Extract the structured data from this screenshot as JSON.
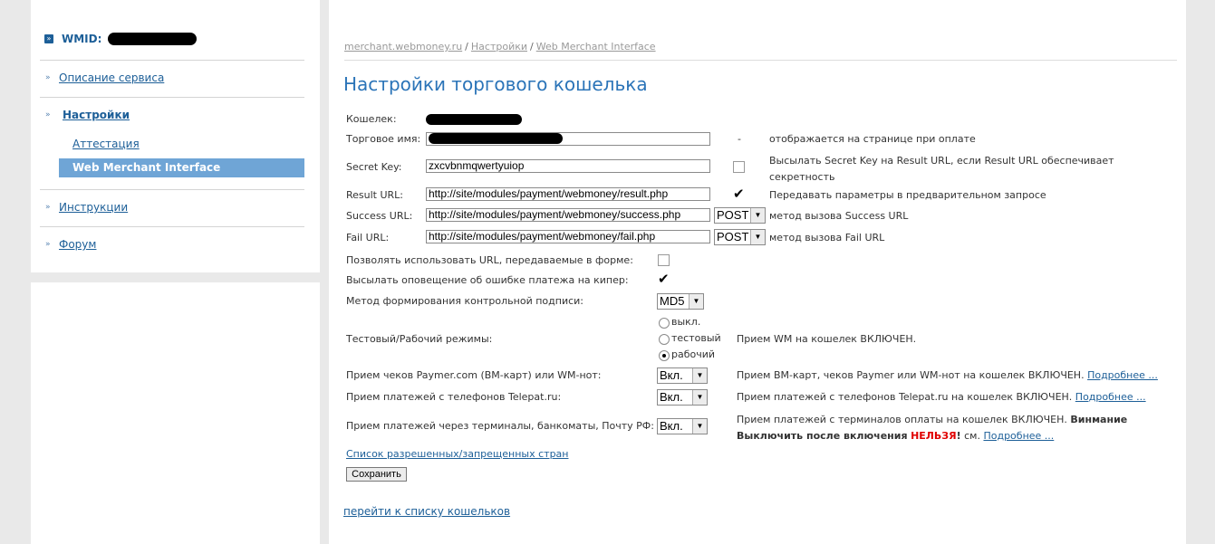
{
  "sidebar": {
    "wmid_label": "WMID:",
    "items": [
      {
        "label": "Описание сервиса"
      },
      {
        "label": "Настройки"
      },
      {
        "label": "Инструкции"
      },
      {
        "label": "Форум"
      }
    ],
    "subitems": [
      {
        "label": "Аттестация"
      },
      {
        "label": "Web Merchant Interface"
      }
    ]
  },
  "breadcrumb": [
    "merchant.webmoney.ru",
    "Настройки",
    "Web Merchant Interface"
  ],
  "breadcrumb_sep": "/",
  "title": "Настройки торгового кошелька",
  "form": {
    "wallet_label": "Кошелек:",
    "trade_name_label": "Торговое имя:",
    "trade_name_dash": "-",
    "trade_name_note": "отображается на странице при оплате",
    "secret_key_label": "Secret Key:",
    "secret_key_value": "zxcvbnmqwertyuiop",
    "secret_key_note": "Высылать Secret Key на Result URL, если Result URL обеспечивает секретность",
    "result_url_label": "Result URL:",
    "result_url_value": "http://site/modules/payment/webmoney/result.php",
    "result_url_note": "Передавать параметры в предварительном запросе",
    "success_url_label": "Success URL:",
    "success_url_value": "http://site/modules/payment/webmoney/success.php",
    "success_method": "POST",
    "success_note": "метод вызова Success URL",
    "fail_url_label": "Fail URL:",
    "fail_url_value": "http://site/modules/payment/webmoney/fail.php",
    "fail_method": "POST",
    "fail_note": "метод вызова Fail URL",
    "allow_urls_label": "Позволять использовать URL, передаваемые в форме:",
    "allow_urls_checked": false,
    "notify_keeper_label": "Высылать оповещение об ошибке платежа на кипер:",
    "notify_keeper_checked": true,
    "sign_method_label": "Метод формирования контрольной подписи:",
    "sign_method_value": "MD5",
    "mode_label": "Тестовый/Рабочий режимы:",
    "mode_options": [
      "выкл.",
      "тестовый",
      "рабочий"
    ],
    "mode_selected": "рабочий",
    "mode_note": "Прием WM на кошелек ВКЛЮЧЕН.",
    "paymer_label": "Прием чеков Paymer.com (ВМ-карт) или WM-нот:",
    "paymer_value": "Вкл.",
    "paymer_note": "Прием ВМ-карт, чеков Paymer или WM-нот на кошелек ВКЛЮЧЕН.",
    "telepat_label": "Прием платежей с телефонов Telepat.ru:",
    "telepat_value": "Вкл.",
    "telepat_note": "Прием платежей с телефонов Telepat.ru на кошелек ВКЛЮЧЕН.",
    "terminals_label": "Прием платежей через терминалы, банкоматы, Почту РФ:",
    "terminals_value": "Вкл.",
    "terminals_note_1": "Прием платежей с терминалов оплаты на кошелек ВКЛЮЧЕН.",
    "terminals_note_bold1": "Винмание",
    "terminals_note_bold2": "Выключить после включения",
    "terminals_note_red": "НЕЛЬЗЯ",
    "terminals_note_excl": "!",
    "terminals_note_see": "см.",
    "more_link": "Подробнее ...",
    "countries_link": "Список разрешенных/запрещенных стран",
    "save_button": "Сохранить"
  },
  "wallets_link": "перейти к списку кошельков",
  "colors": {
    "accent": "#2b74b8",
    "link": "#1d5f98",
    "active_bg": "#6fa5d6",
    "warning": "#e00000"
  }
}
